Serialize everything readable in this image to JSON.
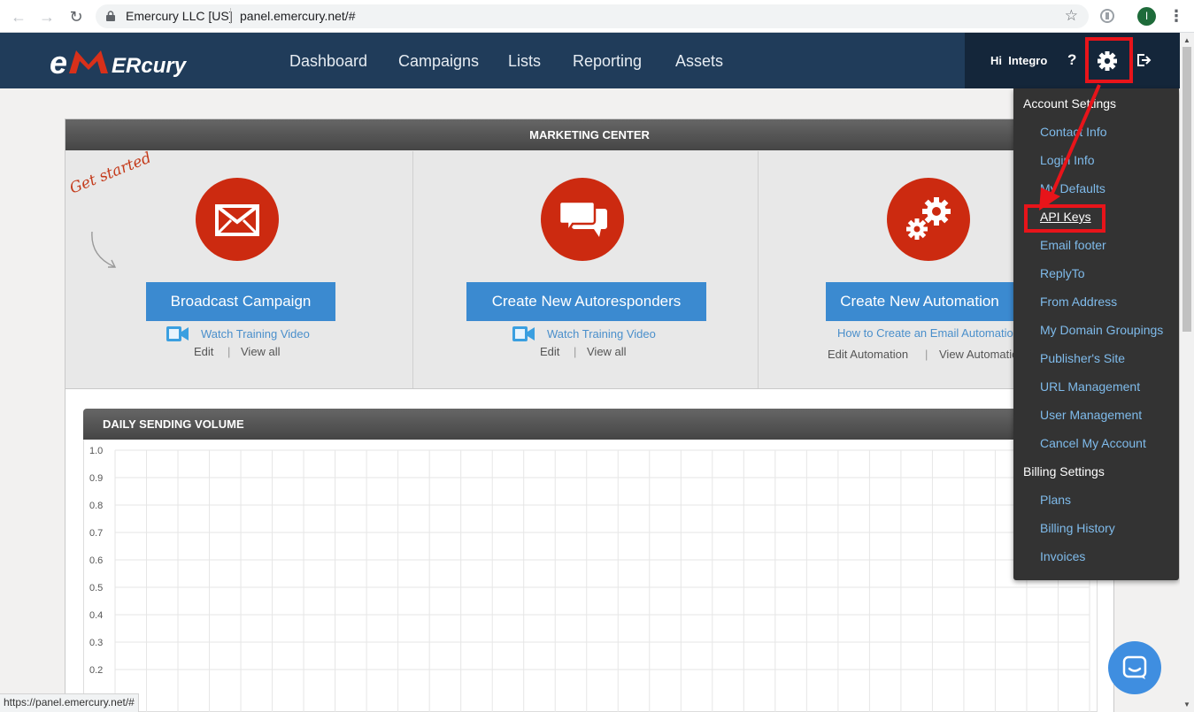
{
  "browser": {
    "site_label": "Emercury LLC [US]",
    "url": "panel.emercury.net/#",
    "profile_initial": "I",
    "status_url": "https://panel.emercury.net/#"
  },
  "header": {
    "logo_text": "eMERcury",
    "nav": [
      "Dashboard",
      "Campaigns",
      "Lists",
      "Reporting",
      "Assets"
    ],
    "greeting": "Hi  Integro",
    "help": "?"
  },
  "marketing_center": {
    "title": "MARKETING CENTER",
    "get_started": "Get started",
    "cards": [
      {
        "button": "Broadcast Campaign",
        "link": "Watch Training Video",
        "edit": "Edit",
        "view": "View all"
      },
      {
        "button": "Create New Autoresponders",
        "link": "Watch Training Video",
        "edit": "Edit",
        "view": "View all"
      },
      {
        "button": "Create New Automation",
        "link": "How to Create an Email Automation",
        "edit": "Edit Automation",
        "view": "View Automations"
      }
    ],
    "separator": "|"
  },
  "daily_volume": {
    "title": "DAILY SENDING VOLUME",
    "y_ticks": [
      "1.0",
      "0.9",
      "0.8",
      "0.7",
      "0.6",
      "0.5",
      "0.4",
      "0.3",
      "0.2"
    ]
  },
  "chart_data": {
    "type": "line",
    "title": "DAILY SENDING VOLUME",
    "xlabel": "",
    "ylabel": "",
    "ylim": [
      0,
      1.0
    ],
    "y_ticks": [
      1.0,
      0.9,
      0.8,
      0.7,
      0.6,
      0.5,
      0.4,
      0.3,
      0.2
    ],
    "grid": true,
    "series": []
  },
  "settings_menu": {
    "account_heading": "Account Settings",
    "account_items": [
      "Contact Info",
      "Login Info",
      "My Defaults",
      "API Keys",
      "Email footer",
      "ReplyTo",
      "From Address",
      "My Domain Groupings",
      "Publisher's Site",
      "URL Management",
      "User Management",
      "Cancel My Account"
    ],
    "billing_heading": "Billing Settings",
    "billing_items": [
      "Plans",
      "Billing History",
      "Invoices"
    ]
  },
  "colors": {
    "header_bg": "#203c5a",
    "accent_blue": "#3b8ad0",
    "icon_red": "#cc2a10",
    "highlight_red": "#e8141a",
    "menu_link": "#7fbbeb"
  }
}
